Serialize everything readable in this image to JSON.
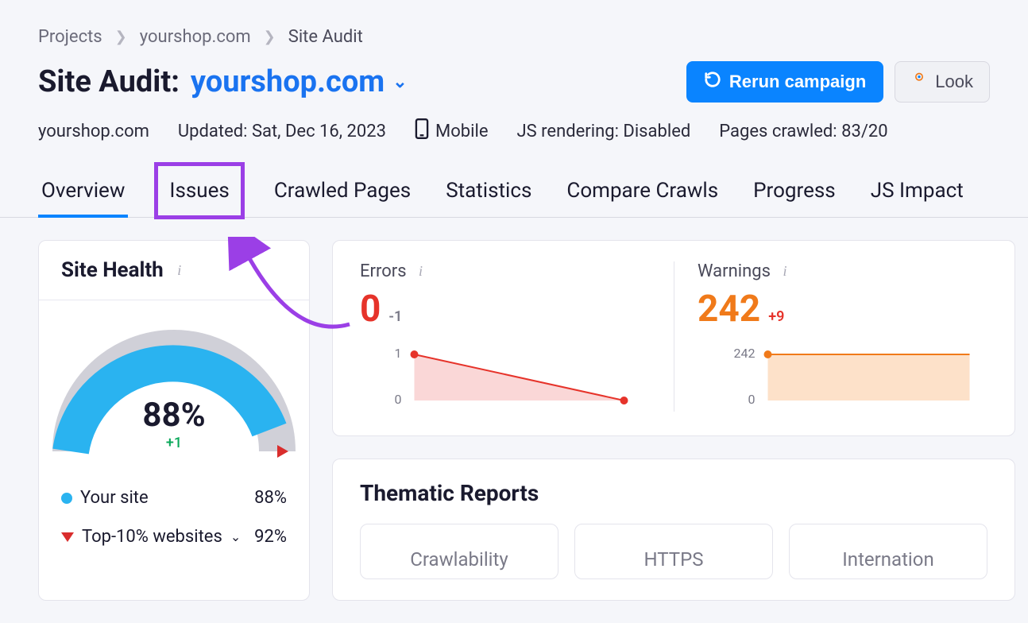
{
  "breadcrumbs": {
    "projects": "Projects",
    "domain": "yourshop.com",
    "current": "Site Audit"
  },
  "header": {
    "title_prefix": "Site Audit:",
    "domain": "yourshop.com",
    "rerun_label": "Rerun campaign",
    "look_label": "Look"
  },
  "meta": {
    "domain": "yourshop.com",
    "updated": "Updated: Sat, Dec 16, 2023",
    "device": "Mobile",
    "js": "JS rendering: Disabled",
    "pages": "Pages crawled: 83/20"
  },
  "tabs": {
    "overview": "Overview",
    "issues": "Issues",
    "crawled": "Crawled Pages",
    "statistics": "Statistics",
    "compare": "Compare Crawls",
    "progress": "Progress",
    "jsimpact": "JS Impact"
  },
  "site_health": {
    "title": "Site Health",
    "pct": "88%",
    "delta": "+1",
    "your_site_label": "Your site",
    "your_site_val": "88%",
    "top10_label": "Top-10% websites",
    "top10_val": "92%"
  },
  "errors": {
    "title": "Errors",
    "value": "0",
    "delta": "-1"
  },
  "warnings": {
    "title": "Warnings",
    "value": "242",
    "delta": "+9"
  },
  "thematic": {
    "title": "Thematic Reports",
    "cards": {
      "crawlability": "Crawlability",
      "https": "HTTPS",
      "internation": "Internation"
    }
  },
  "chart_data": [
    {
      "type": "line",
      "title": "Errors",
      "x": [
        0,
        1
      ],
      "y": [
        1,
        0
      ],
      "ylim": [
        0,
        1
      ],
      "y_ticks": [
        0,
        1
      ],
      "color": "#e6332a",
      "fill": "#fad7d7"
    },
    {
      "type": "line",
      "title": "Warnings",
      "x": [
        0,
        1
      ],
      "y": [
        242,
        242
      ],
      "ylim": [
        0,
        242
      ],
      "y_ticks": [
        0,
        242
      ],
      "color": "#f07a1a",
      "fill": "#fde1c9"
    },
    {
      "type": "gauge",
      "title": "Site Health",
      "value": 88,
      "max": 100,
      "marker": 92,
      "color": "#2ab3f0",
      "remainder_color": "#d0d0d8"
    }
  ]
}
